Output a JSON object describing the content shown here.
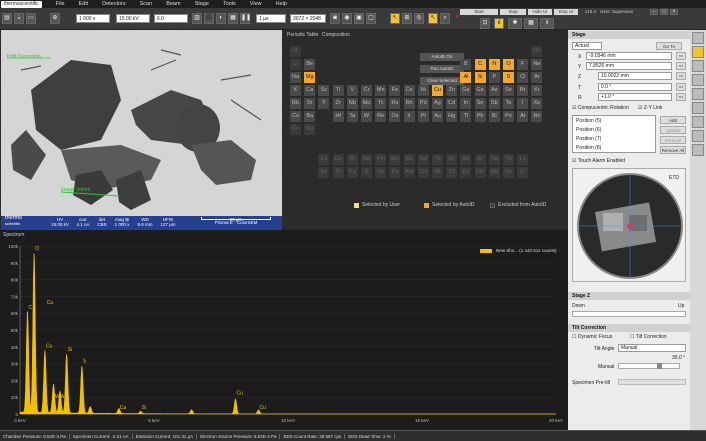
{
  "menu": {
    "logo": "thermoscientific",
    "items": [
      "File",
      "Edit",
      "Detectors",
      "Scan",
      "Beam",
      "Stage",
      "Tools",
      "View",
      "Help"
    ]
  },
  "toolbar": {
    "mag": "1 000 x",
    "hv": "15.00 kV",
    "spot": "6.0",
    "scan": "1 µs",
    "res": "3072 × 2048",
    "buttons": [
      "Start",
      "Stop",
      "Hide UI",
      "Stop UI"
    ],
    "version": "v16.2",
    "user": "User: Supervisor"
  },
  "sem": {
    "label_drift": "Drift Correction",
    "label_image": "Image Inform"
  },
  "databar": {
    "brand1": "thermo",
    "brand2": "scientific",
    "cols": [
      {
        "h": "HV",
        "v": "15.00 kV"
      },
      {
        "h": "curr",
        "v": "4.1 nA"
      },
      {
        "h": "det",
        "v": "CBS"
      },
      {
        "h": "mag ⊞",
        "v": "1 000 x"
      },
      {
        "h": "WD",
        "v": "9.6 mm"
      },
      {
        "h": "HFW",
        "v": "127 µm"
      }
    ],
    "scale": "20 µm",
    "name": "Prisma E - ColorSEM"
  },
  "pt": {
    "tab1": "Periodic Table",
    "tab2": "Composition",
    "btn_autoid": "AutoID On",
    "btn_run": "Run AutoID",
    "btn_clear": "Clear Selected",
    "legend": [
      "Selected by User",
      "Selected by AutoID",
      "Excluded from AutoID"
    ]
  },
  "elements": [
    {
      "s": "H",
      "r": 0,
      "c": 0,
      "t": "f"
    },
    {
      "s": "He",
      "r": 0,
      "c": 17,
      "t": "f"
    },
    {
      "s": "Li",
      "r": 1,
      "c": 0,
      "t": "f"
    },
    {
      "s": "Be",
      "r": 1,
      "c": 1,
      "t": "n"
    },
    {
      "s": "B",
      "r": 1,
      "c": 12,
      "t": "n"
    },
    {
      "s": "C",
      "r": 1,
      "c": 13,
      "t": "s"
    },
    {
      "s": "N",
      "r": 1,
      "c": 14,
      "t": "s"
    },
    {
      "s": "O",
      "r": 1,
      "c": 15,
      "t": "s"
    },
    {
      "s": "F",
      "r": 1,
      "c": 16,
      "t": "n"
    },
    {
      "s": "Ne",
      "r": 1,
      "c": 17,
      "t": "n"
    },
    {
      "s": "Na",
      "r": 2,
      "c": 0,
      "t": "n"
    },
    {
      "s": "Mg",
      "r": 2,
      "c": 1,
      "t": "s"
    },
    {
      "s": "Al",
      "r": 2,
      "c": 12,
      "t": "s"
    },
    {
      "s": "Si",
      "r": 2,
      "c": 13,
      "t": "s"
    },
    {
      "s": "P",
      "r": 2,
      "c": 14,
      "t": "n"
    },
    {
      "s": "S",
      "r": 2,
      "c": 15,
      "t": "s"
    },
    {
      "s": "Cl",
      "r": 2,
      "c": 16,
      "t": "n"
    },
    {
      "s": "Ar",
      "r": 2,
      "c": 17,
      "t": "n"
    },
    {
      "s": "K",
      "r": 3,
      "c": 0,
      "t": "n"
    },
    {
      "s": "Ca",
      "r": 3,
      "c": 1,
      "t": "n"
    },
    {
      "s": "Sc",
      "r": 3,
      "c": 2,
      "t": "n"
    },
    {
      "s": "Ti",
      "r": 3,
      "c": 3,
      "t": "n"
    },
    {
      "s": "V",
      "r": 3,
      "c": 4,
      "t": "n"
    },
    {
      "s": "Cr",
      "r": 3,
      "c": 5,
      "t": "n"
    },
    {
      "s": "Mn",
      "r": 3,
      "c": 6,
      "t": "n"
    },
    {
      "s": "Fe",
      "r": 3,
      "c": 7,
      "t": "n"
    },
    {
      "s": "Co",
      "r": 3,
      "c": 8,
      "t": "n"
    },
    {
      "s": "Ni",
      "r": 3,
      "c": 9,
      "t": "n"
    },
    {
      "s": "Cu",
      "r": 3,
      "c": 10,
      "t": "s"
    },
    {
      "s": "Zn",
      "r": 3,
      "c": 11,
      "t": "n"
    },
    {
      "s": "Ga",
      "r": 3,
      "c": 12,
      "t": "n"
    },
    {
      "s": "Ge",
      "r": 3,
      "c": 13,
      "t": "n"
    },
    {
      "s": "As",
      "r": 3,
      "c": 14,
      "t": "n"
    },
    {
      "s": "Se",
      "r": 3,
      "c": 15,
      "t": "n"
    },
    {
      "s": "Br",
      "r": 3,
      "c": 16,
      "t": "n"
    },
    {
      "s": "Kr",
      "r": 3,
      "c": 17,
      "t": "n"
    },
    {
      "s": "Rb",
      "r": 4,
      "c": 0,
      "t": "n"
    },
    {
      "s": "Sr",
      "r": 4,
      "c": 1,
      "t": "n"
    },
    {
      "s": "Y",
      "r": 4,
      "c": 2,
      "t": "n"
    },
    {
      "s": "Zr",
      "r": 4,
      "c": 3,
      "t": "n"
    },
    {
      "s": "Nb",
      "r": 4,
      "c": 4,
      "t": "n"
    },
    {
      "s": "Mo",
      "r": 4,
      "c": 5,
      "t": "n"
    },
    {
      "s": "Tc",
      "r": 4,
      "c": 6,
      "t": "n"
    },
    {
      "s": "Ru",
      "r": 4,
      "c": 7,
      "t": "n"
    },
    {
      "s": "Rh",
      "r": 4,
      "c": 8,
      "t": "n"
    },
    {
      "s": "Pd",
      "r": 4,
      "c": 9,
      "t": "n"
    },
    {
      "s": "Ag",
      "r": 4,
      "c": 10,
      "t": "n"
    },
    {
      "s": "Cd",
      "r": 4,
      "c": 11,
      "t": "n"
    },
    {
      "s": "In",
      "r": 4,
      "c": 12,
      "t": "n"
    },
    {
      "s": "Sn",
      "r": 4,
      "c": 13,
      "t": "n"
    },
    {
      "s": "Sb",
      "r": 4,
      "c": 14,
      "t": "n"
    },
    {
      "s": "Te",
      "r": 4,
      "c": 15,
      "t": "n"
    },
    {
      "s": "I",
      "r": 4,
      "c": 16,
      "t": "n"
    },
    {
      "s": "Xe",
      "r": 4,
      "c": 17,
      "t": "n"
    },
    {
      "s": "Cs",
      "r": 5,
      "c": 0,
      "t": "n"
    },
    {
      "s": "Ba",
      "r": 5,
      "c": 1,
      "t": "n"
    },
    {
      "s": "Hf",
      "r": 5,
      "c": 3,
      "t": "n"
    },
    {
      "s": "Ta",
      "r": 5,
      "c": 4,
      "t": "n"
    },
    {
      "s": "W",
      "r": 5,
      "c": 5,
      "t": "n"
    },
    {
      "s": "Re",
      "r": 5,
      "c": 6,
      "t": "n"
    },
    {
      "s": "Os",
      "r": 5,
      "c": 7,
      "t": "n"
    },
    {
      "s": "Ir",
      "r": 5,
      "c": 8,
      "t": "n"
    },
    {
      "s": "Pt",
      "r": 5,
      "c": 9,
      "t": "n"
    },
    {
      "s": "Au",
      "r": 5,
      "c": 10,
      "t": "n"
    },
    {
      "s": "Hg",
      "r": 5,
      "c": 11,
      "t": "n"
    },
    {
      "s": "Tl",
      "r": 5,
      "c": 12,
      "t": "n"
    },
    {
      "s": "Pb",
      "r": 5,
      "c": 13,
      "t": "n"
    },
    {
      "s": "Bi",
      "r": 5,
      "c": 14,
      "t": "n"
    },
    {
      "s": "Po",
      "r": 5,
      "c": 15,
      "t": "n"
    },
    {
      "s": "At",
      "r": 5,
      "c": 16,
      "t": "n"
    },
    {
      "s": "Rn",
      "r": 5,
      "c": 17,
      "t": "n"
    },
    {
      "s": "Fr",
      "r": 6,
      "c": 0,
      "t": "f"
    },
    {
      "s": "Ra",
      "r": 6,
      "c": 1,
      "t": "f"
    },
    {
      "s": "La",
      "r": 8,
      "c": 2,
      "t": "f"
    },
    {
      "s": "Ce",
      "r": 8,
      "c": 3,
      "t": "f"
    },
    {
      "s": "Pr",
      "r": 8,
      "c": 4,
      "t": "f"
    },
    {
      "s": "Nd",
      "r": 8,
      "c": 5,
      "t": "f"
    },
    {
      "s": "Pm",
      "r": 8,
      "c": 6,
      "t": "f"
    },
    {
      "s": "Sm",
      "r": 8,
      "c": 7,
      "t": "f"
    },
    {
      "s": "Eu",
      "r": 8,
      "c": 8,
      "t": "f"
    },
    {
      "s": "Gd",
      "r": 8,
      "c": 9,
      "t": "f"
    },
    {
      "s": "Tb",
      "r": 8,
      "c": 10,
      "t": "f"
    },
    {
      "s": "Dy",
      "r": 8,
      "c": 11,
      "t": "f"
    },
    {
      "s": "Ho",
      "r": 8,
      "c": 12,
      "t": "f"
    },
    {
      "s": "Er",
      "r": 8,
      "c": 13,
      "t": "f"
    },
    {
      "s": "Tm",
      "r": 8,
      "c": 14,
      "t": "f"
    },
    {
      "s": "Yb",
      "r": 8,
      "c": 15,
      "t": "f"
    },
    {
      "s": "Lu",
      "r": 8,
      "c": 16,
      "t": "f"
    },
    {
      "s": "Ac",
      "r": 9,
      "c": 2,
      "t": "f"
    },
    {
      "s": "Th",
      "r": 9,
      "c": 3,
      "t": "f"
    },
    {
      "s": "Pa",
      "r": 9,
      "c": 4,
      "t": "f"
    },
    {
      "s": "U",
      "r": 9,
      "c": 5,
      "t": "f"
    },
    {
      "s": "Np",
      "r": 9,
      "c": 6,
      "t": "f"
    },
    {
      "s": "Pu",
      "r": 9,
      "c": 7,
      "t": "f"
    },
    {
      "s": "Am",
      "r": 9,
      "c": 8,
      "t": "f"
    },
    {
      "s": "Cm",
      "r": 9,
      "c": 9,
      "t": "f"
    },
    {
      "s": "Bk",
      "r": 9,
      "c": 10,
      "t": "f"
    },
    {
      "s": "Cf",
      "r": 9,
      "c": 11,
      "t": "f"
    },
    {
      "s": "Es",
      "r": 9,
      "c": 12,
      "t": "f"
    },
    {
      "s": "Fm",
      "r": 9,
      "c": 13,
      "t": "f"
    },
    {
      "s": "Md",
      "r": 9,
      "c": 14,
      "t": "f"
    },
    {
      "s": "No",
      "r": 9,
      "c": 15,
      "t": "f"
    },
    {
      "s": "Lr",
      "r": 9,
      "c": 16,
      "t": "f"
    }
  ],
  "stage": {
    "title": "Stage",
    "mode": "Actual",
    "goto": "Go To",
    "x_label": "X",
    "x": "-9.0346 mm",
    "y_label": "Y",
    "y": "7.8526 mm",
    "z_label": "Z",
    "z": "10.0022 mm",
    "t_label": "T",
    "t": "0.0 °",
    "r_label": "R",
    "r": "+1.0 °",
    "comp_rot": "Compucentric Rotation",
    "zy_link": "Z-Y Link",
    "positions": [
      "Position (5)",
      "Position (6)",
      "Position (7)",
      "Position (8)"
    ],
    "btn_add": "Add",
    "btn_update": "Update",
    "btn_remove": "Remove",
    "btn_remove_all": "Remove All",
    "touch_alarm": "Touch Alarm Enabled",
    "nav_label": "ETD"
  },
  "stage_z": {
    "title": "Stage Z",
    "down": "Down",
    "up": "Up"
  },
  "tilt": {
    "title": "Tilt Correction",
    "dynamic": "Dynamic Focus",
    "tilt_corr": "Tilt Correction",
    "angle_label": "Tilt Angle",
    "angle_mode": "Manual",
    "angle_val": "35.0 °",
    "manual_label": "Manual",
    "pretilt": "Specimen Pre-tilt"
  },
  "spectrum": {
    "title": "Spectrum",
    "legend": "New Sho... (1 440 611 counts)"
  },
  "chart_data": {
    "type": "area",
    "title": "",
    "xlabel": "",
    "ylabel": "",
    "xlim": [
      0,
      20
    ],
    "ylim": [
      0,
      100000
    ],
    "x_ticks": [
      "0 keV",
      "5 keV",
      "10 keV",
      "15 keV",
      "20 keV"
    ],
    "y_ticks": [
      "0",
      "10k",
      "20k",
      "30k",
      "40k",
      "50k",
      "60k",
      "70k",
      "80k",
      "90k",
      "100k"
    ],
    "series": [
      {
        "name": "New Sho... (1 440 611 counts)",
        "color": "#f2c000",
        "peaks": [
          {
            "e": 0.28,
            "h": 60000
          },
          {
            "e": 0.525,
            "h": 95000
          },
          {
            "e": 0.93,
            "h": 37000
          },
          {
            "e": 1.25,
            "h": 17000
          },
          {
            "e": 1.49,
            "h": 13000
          },
          {
            "e": 1.74,
            "h": 35000
          },
          {
            "e": 2.31,
            "h": 28000
          },
          {
            "e": 2.62,
            "h": 4000
          },
          {
            "e": 3.69,
            "h": 3000
          },
          {
            "e": 4.5,
            "h": 1500
          },
          {
            "e": 6.4,
            "h": 2500
          },
          {
            "e": 8.04,
            "h": 9000
          },
          {
            "e": 8.9,
            "h": 2500
          }
        ]
      }
    ],
    "peak_labels": [
      {
        "e": 0.28,
        "y": 62000,
        "t": "C"
      },
      {
        "e": 0.525,
        "y": 97000,
        "t": "O"
      },
      {
        "e": 0.93,
        "y": 39000,
        "t": "Cu"
      },
      {
        "e": 0.96,
        "y": 65000,
        "t": "Cu"
      },
      {
        "e": 1.25,
        "y": 9000,
        "t": "Mg"
      },
      {
        "e": 1.49,
        "y": 9000,
        "t": "Al"
      },
      {
        "e": 1.74,
        "y": 37000,
        "t": "Si"
      },
      {
        "e": 2.31,
        "y": 30000,
        "t": "S"
      },
      {
        "e": 3.69,
        "y": 2500,
        "t": "Ca"
      },
      {
        "e": 4.5,
        "y": 2500,
        "t": "Si"
      },
      {
        "e": 8.04,
        "y": 11000,
        "t": "Cu"
      },
      {
        "e": 8.9,
        "y": 2500,
        "t": "Cu"
      }
    ]
  },
  "status": {
    "items": [
      "Chamber Pressure: 8.52E-4 Pa",
      "Specimen Current: -2.21 nA",
      "Emission Current: 101.31 µA",
      "Electron Source Pressure: 8.52E-4 Pa",
      "EDS Count Rate: 38 587 cps",
      "EDS Dead Time: 2 %"
    ]
  }
}
